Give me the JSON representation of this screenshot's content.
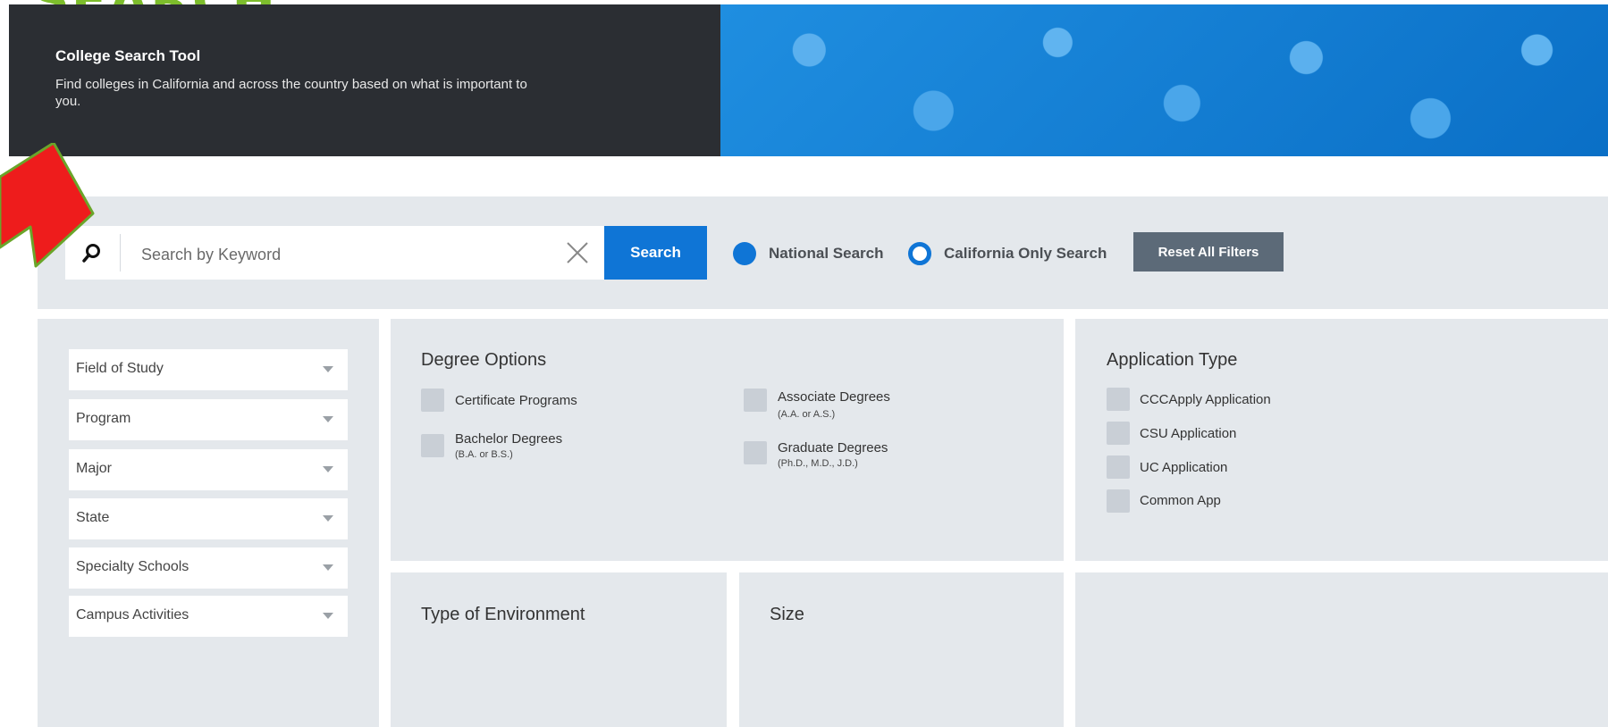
{
  "partial_heading": "SEARCH",
  "hero": {
    "title": "College Search Tool",
    "description": "Find colleges in California and across the country based on what is important to you."
  },
  "search": {
    "placeholder": "Search by Keyword",
    "value": "",
    "button_label": "Search",
    "options": [
      {
        "label": "National Search",
        "selected": true
      },
      {
        "label": "California Only Search",
        "selected": false
      }
    ],
    "reset_label": "Reset All Filters"
  },
  "filters": [
    {
      "label": "Field of Study"
    },
    {
      "label": "Program"
    },
    {
      "label": "Major"
    },
    {
      "label": "State"
    },
    {
      "label": "Specialty Schools"
    },
    {
      "label": "Campus Activities"
    }
  ],
  "degree_options": {
    "title": "Degree Options",
    "items": [
      {
        "label": "Certificate Programs",
        "sub": ""
      },
      {
        "label": "Associate Degrees",
        "sub": "(A.A. or A.S.)"
      },
      {
        "label": "Bachelor Degrees",
        "sub": "(B.A. or B.S.)"
      },
      {
        "label": "Graduate Degrees",
        "sub": "(Ph.D., M.D., J.D.)"
      }
    ]
  },
  "application_type": {
    "title": "Application Type",
    "items": [
      {
        "label": "CCCApply Application"
      },
      {
        "label": "CSU Application"
      },
      {
        "label": "UC Application"
      },
      {
        "label": "Common App"
      }
    ]
  },
  "environment": {
    "title": "Type of Environment"
  },
  "size": {
    "title": "Size"
  },
  "colors": {
    "accent": "#0f75d6",
    "hero_dark": "#2b2e33",
    "panel_bg": "#e4e8ec",
    "reset_button": "#5c6a78",
    "arrow": "#ee1c1c",
    "arrow_outline": "#6aa52a"
  }
}
